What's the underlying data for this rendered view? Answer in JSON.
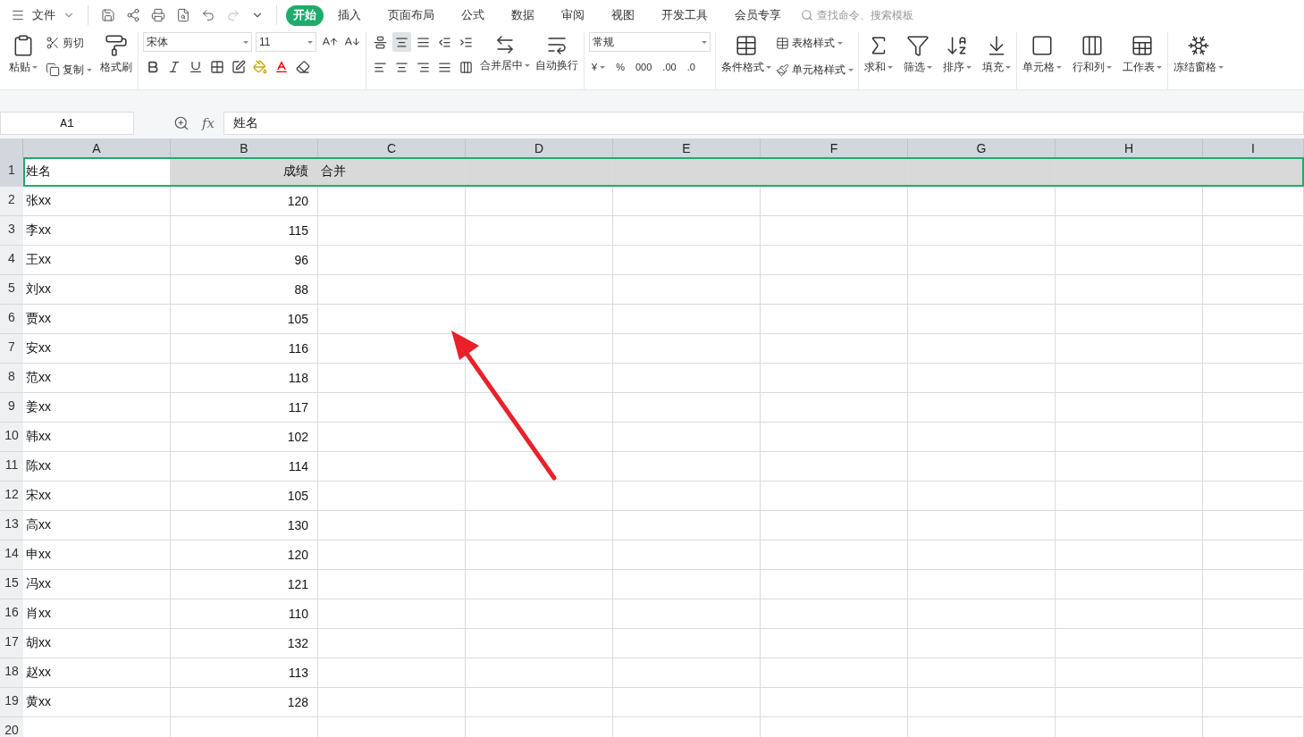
{
  "menu": {
    "label": "文件"
  },
  "tabs": [
    {
      "label": "开始",
      "selected": true
    },
    {
      "label": "插入",
      "selected": false
    },
    {
      "label": "页面布局",
      "selected": false
    },
    {
      "label": "公式",
      "selected": false
    },
    {
      "label": "数据",
      "selected": false
    },
    {
      "label": "审阅",
      "selected": false
    },
    {
      "label": "视图",
      "selected": false
    },
    {
      "label": "开发工具",
      "selected": false
    },
    {
      "label": "会员专享",
      "selected": false
    }
  ],
  "search": {
    "placeholder": "查找命令、搜索模板"
  },
  "clipboard": {
    "paste": {
      "label": "粘贴",
      "dropdown": true
    },
    "cut": {
      "label": "剪切"
    },
    "copy": {
      "label": "复制",
      "dropdown": true
    },
    "painter": {
      "label": "格式刷"
    }
  },
  "font": {
    "name": "宋体",
    "size": "11"
  },
  "alignment": {
    "vertical": [
      {
        "selected": false
      },
      {
        "selected": true
      },
      {
        "selected": false
      }
    ],
    "merge": {
      "label": "合并居中",
      "dropdown": true
    },
    "wrap": {
      "label": "自动换行"
    }
  },
  "number": {
    "format": "常规",
    "currency": "¥",
    "percent": "%",
    "thousands": "000",
    "add_decimal": ".00",
    "remove_decimal": ".0"
  },
  "styles": {
    "conditional": {
      "label": "条件格式",
      "dropdown": true
    },
    "table_style": {
      "label": "表格样式",
      "dropdown": true
    },
    "cell_style": {
      "label": "单元格样式",
      "dropdown": true
    }
  },
  "tools": [
    {
      "label": "求和",
      "dropdown": true
    },
    {
      "label": "筛选",
      "dropdown": true
    },
    {
      "label": "排序",
      "dropdown": true
    },
    {
      "label": "填充",
      "dropdown": true
    }
  ],
  "cell_tools": [
    {
      "label": "单元格",
      "dropdown": true
    },
    {
      "label": "行和列",
      "dropdown": true
    },
    {
      "label": "工作表",
      "dropdown": true
    }
  ],
  "freeze": {
    "label": "冻结窗格",
    "dropdown": true
  },
  "formula_bar": {
    "name_box": "A1",
    "fx": "fx",
    "formula": "姓名"
  },
  "sheet": {
    "columns": [
      {
        "label": "A",
        "kind": "text"
      },
      {
        "label": "B",
        "kind": "number"
      },
      {
        "label": "C",
        "kind": "text"
      },
      {
        "label": "D",
        "kind": "text"
      },
      {
        "label": "E",
        "kind": "text"
      },
      {
        "label": "F",
        "kind": "text"
      },
      {
        "label": "G",
        "kind": "text"
      },
      {
        "label": "H",
        "kind": "text"
      },
      {
        "label": "I",
        "kind": "text"
      }
    ],
    "rows": [
      {
        "header": "1",
        "selected": true,
        "cells": [
          "姓名",
          "成绩",
          "合并"
        ]
      },
      {
        "header": "2",
        "selected": false,
        "cells": [
          "张xx",
          "120"
        ]
      },
      {
        "header": "3",
        "selected": false,
        "cells": [
          "李xx",
          "115"
        ]
      },
      {
        "header": "4",
        "selected": false,
        "cells": [
          "王xx",
          "96"
        ]
      },
      {
        "header": "5",
        "selected": false,
        "cells": [
          "刘xx",
          "88"
        ]
      },
      {
        "header": "6",
        "selected": false,
        "cells": [
          "贾xx",
          "105"
        ]
      },
      {
        "header": "7",
        "selected": false,
        "cells": [
          "安xx",
          "116"
        ]
      },
      {
        "header": "8",
        "selected": false,
        "cells": [
          "范xx",
          "118"
        ]
      },
      {
        "header": "9",
        "selected": false,
        "cells": [
          "姜xx",
          "117"
        ]
      },
      {
        "header": "10",
        "selected": false,
        "cells": [
          "韩xx",
          "102"
        ]
      },
      {
        "header": "11",
        "selected": false,
        "cells": [
          "陈xx",
          "114"
        ]
      },
      {
        "header": "12",
        "selected": false,
        "cells": [
          "宋xx",
          "105"
        ]
      },
      {
        "header": "13",
        "selected": false,
        "cells": [
          "高xx",
          "130"
        ]
      },
      {
        "header": "14",
        "selected": false,
        "cells": [
          "申xx",
          "120"
        ]
      },
      {
        "header": "15",
        "selected": false,
        "cells": [
          "冯xx",
          "121"
        ]
      },
      {
        "header": "16",
        "selected": false,
        "cells": [
          "肖xx",
          "110"
        ]
      },
      {
        "header": "17",
        "selected": false,
        "cells": [
          "胡xx",
          "132"
        ]
      },
      {
        "header": "18",
        "selected": false,
        "cells": [
          "赵xx",
          "113"
        ]
      },
      {
        "header": "19",
        "selected": false,
        "cells": [
          "黄xx",
          "128"
        ]
      },
      {
        "header": "20",
        "selected": false,
        "cells": []
      }
    ]
  }
}
